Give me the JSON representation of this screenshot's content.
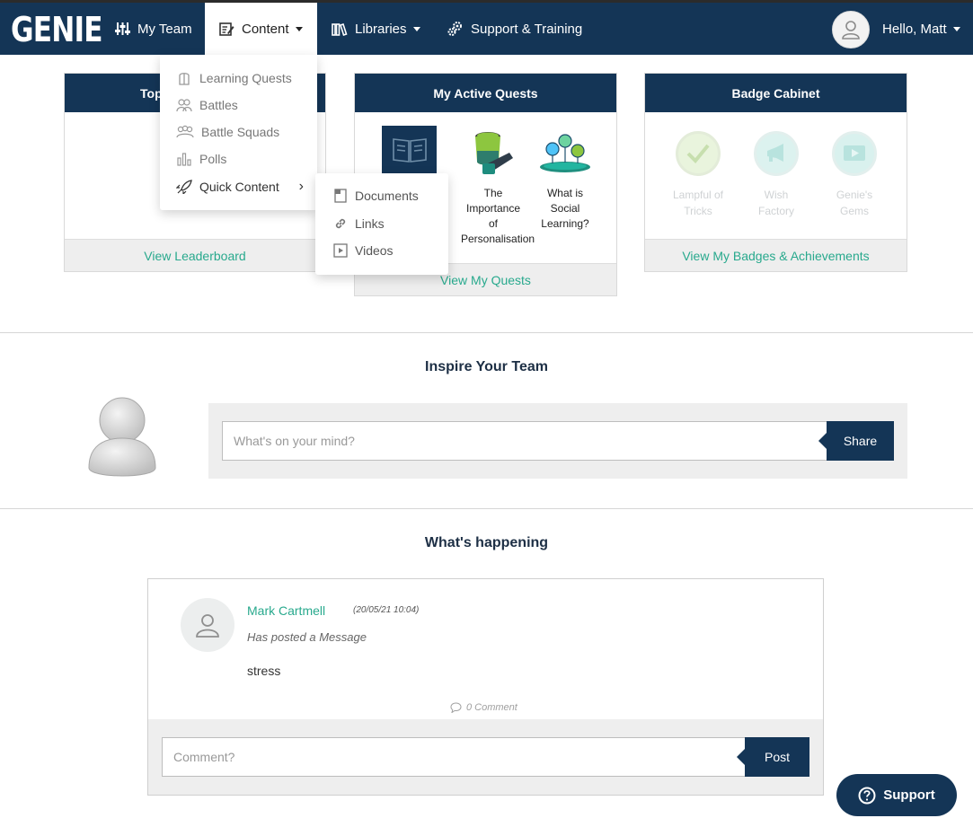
{
  "nav": {
    "logo": "GENIE",
    "my_team": "My Team",
    "content": "Content",
    "libraries": "Libraries",
    "support_training": "Support & Training",
    "greeting": "Hello, Matt"
  },
  "content_menu": {
    "items": [
      "Learning Quests",
      "Battles",
      "Battle Squads",
      "Polls",
      "Quick Content"
    ],
    "submenu": [
      "Documents",
      "Links",
      "Videos"
    ]
  },
  "leaderboard_card": {
    "title_partial": "Top",
    "footer": "View Leaderboard"
  },
  "quests_card": {
    "title": "My Active Quests",
    "quests": [
      {
        "label": ""
      },
      {
        "label": "The Importance of Personalisation"
      },
      {
        "label": "What is Social Learning?"
      }
    ],
    "footer": "View My Quests"
  },
  "badges_card": {
    "title": "Badge Cabinet",
    "badges": [
      "Lampful of Tricks",
      "Wish Factory",
      "Genie's Gems"
    ],
    "footer": "View My Badges & Achievements"
  },
  "inspire": {
    "title": "Inspire Your Team",
    "placeholder": "What's on your mind?",
    "share": "Share"
  },
  "happening": {
    "title": "What's happening",
    "post": {
      "author": "Mark Cartmell",
      "time": "(20/05/21 10:04)",
      "action": "Has posted a Message",
      "text": "stress",
      "comments": "0 Comment"
    },
    "comment_placeholder": "Comment?",
    "post_button": "Post"
  },
  "support": "Support",
  "colors": {
    "navy": "#143556",
    "teal_link": "#28a98d",
    "panel_grey": "#eeeeee"
  }
}
